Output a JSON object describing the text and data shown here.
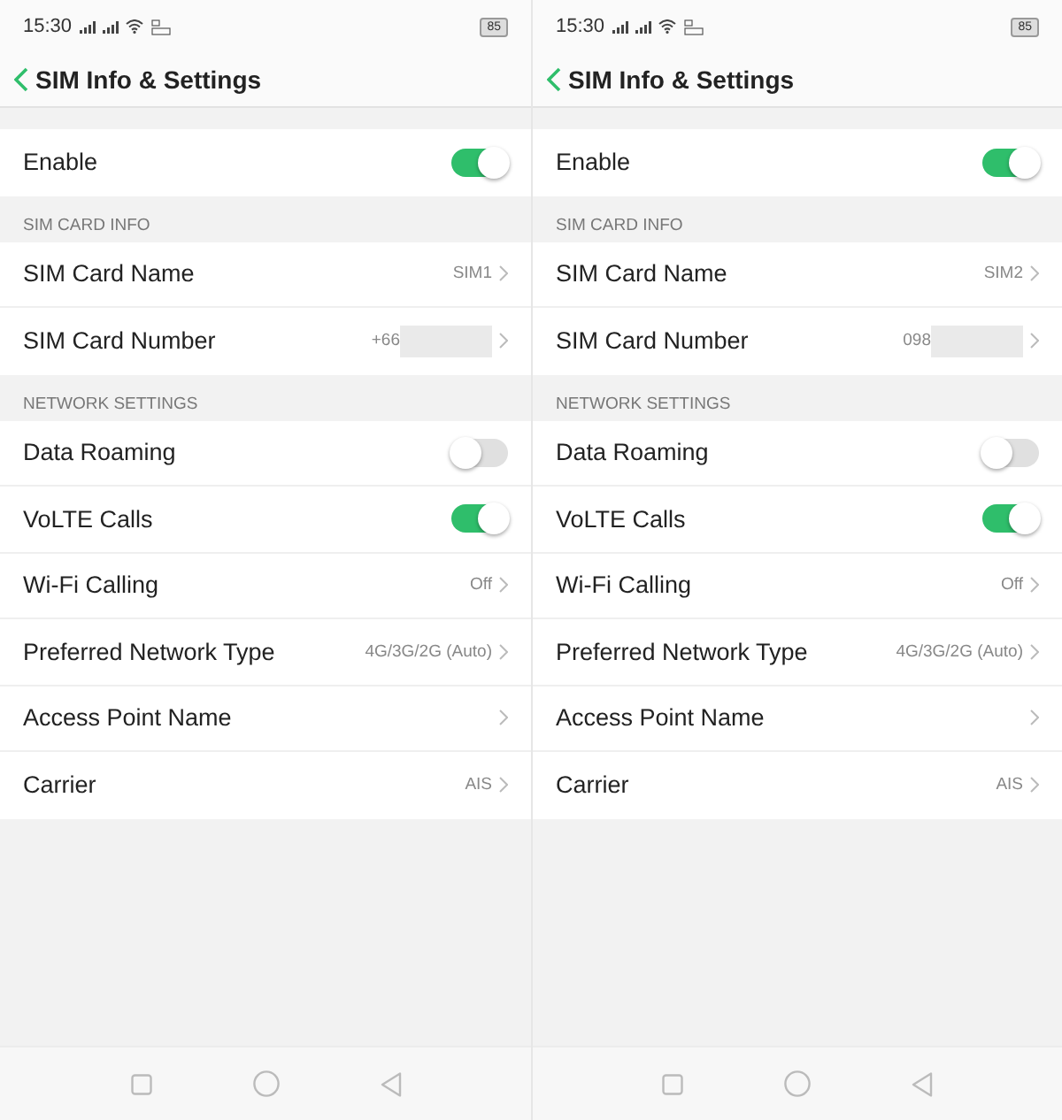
{
  "screens": [
    {
      "status_bar": {
        "time": "15:30",
        "battery": "85"
      },
      "title": "SIM Info & Settings",
      "sections": [
        {
          "rows": [
            {
              "kind": "toggle",
              "label": "Enable",
              "on": true
            }
          ]
        },
        {
          "header": "SIM CARD INFO",
          "rows": [
            {
              "kind": "link",
              "label": "SIM Card Name",
              "value": "SIM1"
            },
            {
              "kind": "link",
              "label": "SIM Card Number",
              "value": "+66",
              "masked": true
            }
          ]
        },
        {
          "header": "NETWORK SETTINGS",
          "rows": [
            {
              "kind": "toggle",
              "label": "Data Roaming",
              "on": false
            },
            {
              "kind": "toggle",
              "label": "VoLTE Calls",
              "on": true
            },
            {
              "kind": "link",
              "label": "Wi-Fi Calling",
              "value": "Off"
            },
            {
              "kind": "link",
              "label": "Preferred Network Type",
              "value": "4G/3G/2G (Auto)"
            },
            {
              "kind": "link",
              "label": "Access Point Name"
            },
            {
              "kind": "link",
              "label": "Carrier",
              "value": "AIS"
            }
          ]
        }
      ]
    },
    {
      "status_bar": {
        "time": "15:30",
        "battery": "85"
      },
      "title": "SIM Info & Settings",
      "sections": [
        {
          "rows": [
            {
              "kind": "toggle",
              "label": "Enable",
              "on": true
            }
          ]
        },
        {
          "header": "SIM CARD INFO",
          "rows": [
            {
              "kind": "link",
              "label": "SIM Card Name",
              "value": "SIM2"
            },
            {
              "kind": "link",
              "label": "SIM Card Number",
              "value": "098",
              "masked": true
            }
          ]
        },
        {
          "header": "NETWORK SETTINGS",
          "rows": [
            {
              "kind": "toggle",
              "label": "Data Roaming",
              "on": false
            },
            {
              "kind": "toggle",
              "label": "VoLTE Calls",
              "on": true
            },
            {
              "kind": "link",
              "label": "Wi-Fi Calling",
              "value": "Off"
            },
            {
              "kind": "link",
              "label": "Preferred Network Type",
              "value": "4G/3G/2G (Auto)"
            },
            {
              "kind": "link",
              "label": "Access Point Name"
            },
            {
              "kind": "link",
              "label": "Carrier",
              "value": "AIS"
            }
          ]
        }
      ]
    }
  ]
}
